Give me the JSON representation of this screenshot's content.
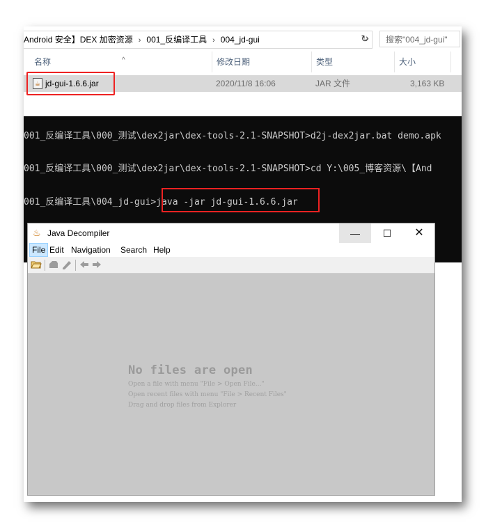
{
  "explorer": {
    "breadcrumb": [
      "Android 安全】DEX 加密资源",
      "001_反编译工具",
      "004_jd-gui"
    ],
    "breadcrumb_separator": "›",
    "search_placeholder": "搜索\"004_jd-gui\"",
    "columns": {
      "name": "名称",
      "modified": "修改日期",
      "type": "类型",
      "size": "大小"
    },
    "file": {
      "name": "jd-gui-1.6.6.jar",
      "modified": "2020/11/8 16:06",
      "type": "JAR 文件",
      "size": "3,163 KB"
    }
  },
  "console": {
    "lines": [
      "001_反编译工具\\000_测试\\dex2jar\\dex-tools-2.1-SNAPSHOT>d2j-dex2jar.bat demo.apk",
      "001_反编译工具\\000_测试\\dex2jar\\dex-tools-2.1-SNAPSHOT>cd Y:\\005_博客资源\\【And",
      "001_反编译工具\\004_jd-gui>"
    ],
    "command": "java -jar jd-gui-1.6.6.jar"
  },
  "jd": {
    "title": "Java Decompiler",
    "menu": [
      "File",
      "Edit",
      "Navigation",
      "Search",
      "Help"
    ],
    "window_buttons": {
      "minimize": "—",
      "maximize": "☐",
      "close": "✕"
    },
    "empty_title": "No files are open",
    "hints": [
      "Open a file with menu \"File > Open File...\"",
      "Open recent files with menu \"File > Recent Files\"",
      "Drag and drop files from Explorer"
    ]
  },
  "icons": {
    "open": "folder-open-icon",
    "close": "close-file-icon",
    "save": "save-icon",
    "back": "back-arrow-icon",
    "forward": "forward-arrow-icon",
    "refresh": "refresh-icon"
  },
  "colors": {
    "highlight": "#ee2222",
    "console_bg": "#0c0c0c",
    "jd_content_bg": "#c8c8c8"
  }
}
